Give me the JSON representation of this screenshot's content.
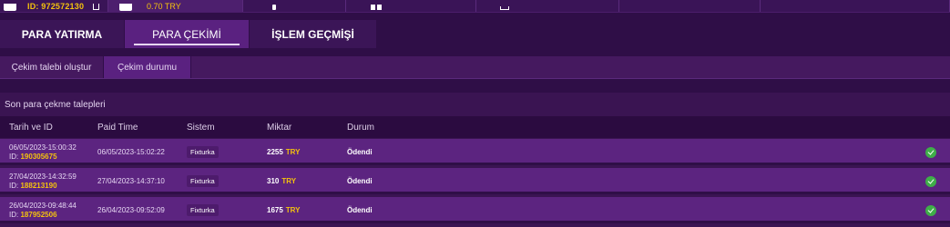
{
  "topbar": {
    "account_id": "ID: 972572130",
    "balance": "0.70 TRY"
  },
  "main_tabs": [
    {
      "label": "PARA YATIRMA",
      "active": false
    },
    {
      "label": "PARA ÇEKİMİ",
      "active": true
    },
    {
      "label": "İŞLEM GEÇMİŞİ",
      "active": false
    }
  ],
  "sub_tabs": [
    {
      "label": "Çekim talebi oluştur",
      "active": false
    },
    {
      "label": "Çekim durumu",
      "active": true
    }
  ],
  "panel": {
    "title": "Son para çekme talepleri",
    "columns": [
      "Tarih ve ID",
      "Paid Time",
      "Sistem",
      "Miktar",
      "Durum"
    ],
    "rows": [
      {
        "date": "06/05/2023-15:00:32",
        "id_prefix": "ID:",
        "id": "190305675",
        "paid_time": "06/05/2023-15:02:22",
        "system": "Fixturka",
        "amount": "2255",
        "currency": "TRY",
        "status": "Ödendi"
      },
      {
        "date": "27/04/2023-14:32:59",
        "id_prefix": "ID:",
        "id": "188213190",
        "paid_time": "27/04/2023-14:37:10",
        "system": "Fixturka",
        "amount": "310",
        "currency": "TRY",
        "status": "Ödendi"
      },
      {
        "date": "26/04/2023-09:48:44",
        "id_prefix": "ID:",
        "id": "187952506",
        "paid_time": "26/04/2023-09:52:09",
        "system": "Fixturka",
        "amount": "1675",
        "currency": "TRY",
        "status": "Ödendi"
      }
    ]
  },
  "colors": {
    "background": "#2f0e47",
    "active_tab": "#5a2180",
    "row_bg": "#5c2480",
    "accent_yellow": "#f4c20d",
    "success_green": "#3fae49"
  },
  "icons": {
    "account": "user-icon",
    "copy": "copy-icon",
    "wallet": "wallet-icon",
    "status_ok": "check-circle-icon"
  }
}
